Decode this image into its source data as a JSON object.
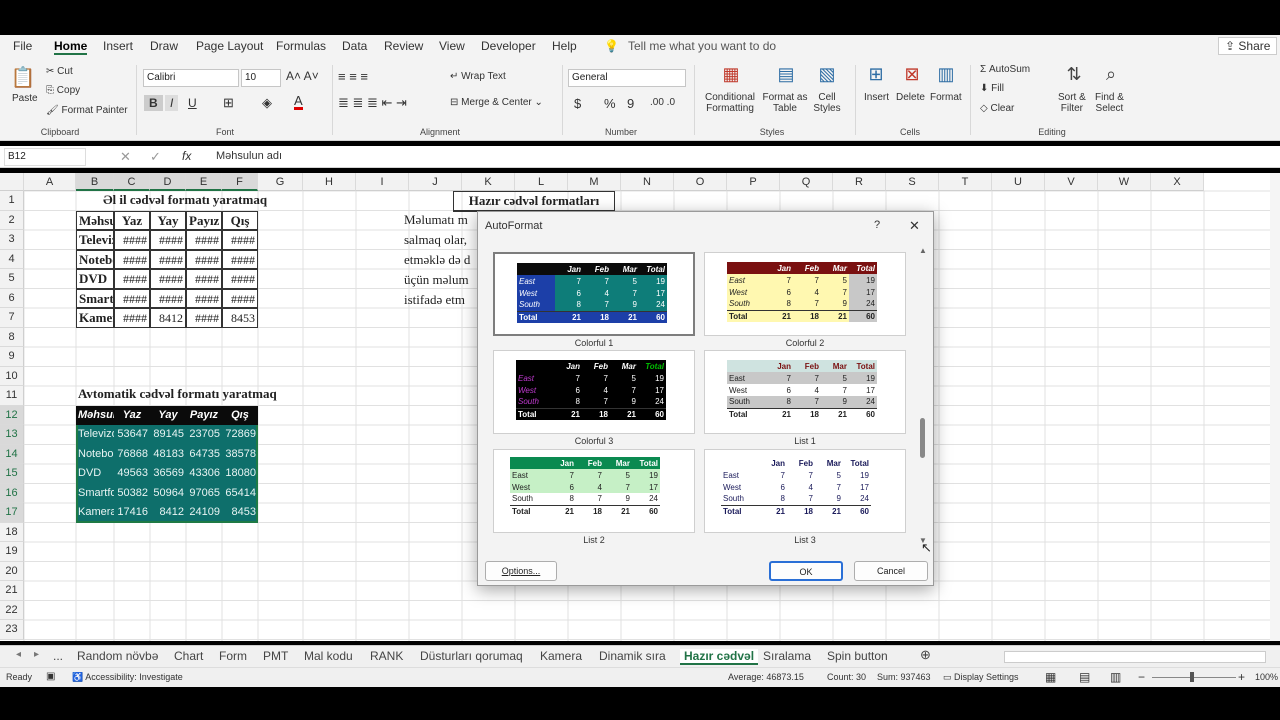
{
  "menu": [
    "File",
    "Home",
    "Insert",
    "Draw",
    "Page Layout",
    "Formulas",
    "Data",
    "Review",
    "View",
    "Developer",
    "Help"
  ],
  "tell_me": "Tell me what you want to do",
  "share": "Share",
  "ribbon": {
    "clipboard": {
      "paste": "Paste",
      "cut": "Cut",
      "copy": "Copy",
      "format_painter": "Format Painter",
      "label": "Clipboard"
    },
    "font": {
      "name": "Calibri",
      "size": "10",
      "label": "Font",
      "bold": "B",
      "italic": "I",
      "underline": "U"
    },
    "alignment": {
      "wrap": "Wrap Text",
      "merge": "Merge & Center",
      "label": "Alignment"
    },
    "number": {
      "format": "General",
      "label": "Number",
      "currency": "$",
      "percent": "%",
      "comma": "9"
    },
    "styles": {
      "conditional": [
        "Conditional",
        "Formatting"
      ],
      "format_as": [
        "Format as",
        "Table"
      ],
      "cell_styles": [
        "Cell",
        "Styles"
      ],
      "label": "Styles"
    },
    "cells": {
      "insert": "Insert",
      "delete": "Delete",
      "format": "Format",
      "label": "Cells"
    },
    "editing": {
      "autosum": "AutoSum",
      "fill": "Fill",
      "clear": "Clear",
      "sort": [
        "Sort &",
        "Filter"
      ],
      "find": [
        "Find &",
        "Select"
      ],
      "label": "Editing"
    }
  },
  "formula_bar": {
    "name_box": "B12",
    "fx": "fx",
    "value": "Məhsulun adı"
  },
  "columns": [
    "A",
    "B",
    "C",
    "D",
    "E",
    "F",
    "G",
    "H",
    "I",
    "J",
    "K",
    "L",
    "M",
    "N",
    "O",
    "P",
    "Q",
    "R",
    "S",
    "T",
    "U",
    "V",
    "W",
    "X"
  ],
  "rows": [
    "1",
    "2",
    "3",
    "4",
    "5",
    "6",
    "7",
    "8",
    "9",
    "10",
    "11",
    "12",
    "13",
    "14",
    "15",
    "16",
    "17",
    "18",
    "19",
    "20",
    "21",
    "22",
    "23"
  ],
  "sheet": {
    "title1": "Əl il cədvəl formatı yaratmaq",
    "table1": {
      "headers": [
        "Məhsulun a",
        "Yaz",
        "Yay",
        "Payız",
        "Qış"
      ],
      "rows": [
        [
          "Televizor",
          "####",
          "####",
          "####",
          "####"
        ],
        [
          "Notebook",
          "####",
          "####",
          "####",
          "####"
        ],
        [
          "DVD",
          "####",
          "####",
          "####",
          "####"
        ],
        [
          "Smartfon",
          "####",
          "####",
          "####",
          "####"
        ],
        [
          "Kamera",
          "####",
          "8412",
          "####",
          "8453"
        ]
      ]
    },
    "title2": "Avtomatik cədvəl formatı yaratmaq",
    "table2": {
      "headers": [
        "Məhsulun adı",
        "Yaz",
        "Yay",
        "Payız",
        "Qış"
      ],
      "rows": [
        [
          "Televizor",
          "53647",
          "89145",
          "23705",
          "72869"
        ],
        [
          "Notebook",
          "76868",
          "48183",
          "64735",
          "38578"
        ],
        [
          "DVD",
          "49563",
          "36569",
          "43306",
          "18080"
        ],
        [
          "Smartfon",
          "50382",
          "50964",
          "97065",
          "65414"
        ],
        [
          "Kamera",
          "17416",
          "8412",
          "24109",
          "8453"
        ]
      ]
    },
    "heading_right": "Hazır cədvəl formatları",
    "text_lines": [
      "Məlumatı m",
      "salmaq olar,",
      "etməklə də d",
      "üçün məlum",
      "istifadə etm"
    ]
  },
  "dialog": {
    "title": "AutoFormat",
    "help": "?",
    "close": "✕",
    "swatches": [
      "Colorful 1",
      "Colorful 2",
      "Colorful 3",
      "List 1",
      "List 2",
      "List 3"
    ],
    "sample": {
      "header": [
        "",
        "Jan",
        "Feb",
        "Mar",
        "Total"
      ],
      "rows": [
        [
          "East",
          "7",
          "7",
          "5",
          "19"
        ],
        [
          "West",
          "6",
          "4",
          "7",
          "17"
        ],
        [
          "South",
          "8",
          "7",
          "9",
          "24"
        ],
        [
          "Total",
          "21",
          "18",
          "21",
          "60"
        ]
      ]
    },
    "options": "Options...",
    "ok": "OK",
    "cancel": "Cancel"
  },
  "tabs": [
    "...",
    "Random növbə",
    "Chart",
    "Form",
    "PMT",
    "Mal kodu",
    "RANK",
    "Düsturları qorumaq",
    "Kamera",
    "Dinamik sıra",
    "Hazır cədvəl",
    "Sıralama",
    "Spin button"
  ],
  "active_tab": "Hazır cədvəl",
  "status": {
    "ready": "Ready",
    "accessibility": "Accessibility: Investigate",
    "average": "Average: 46873.15",
    "count": "Count: 30",
    "sum": "Sum: 937463",
    "display": "Display Settings",
    "zoom": "100%"
  },
  "colors": {
    "teal": "#0e6f6b",
    "excel_green": "#217346"
  }
}
